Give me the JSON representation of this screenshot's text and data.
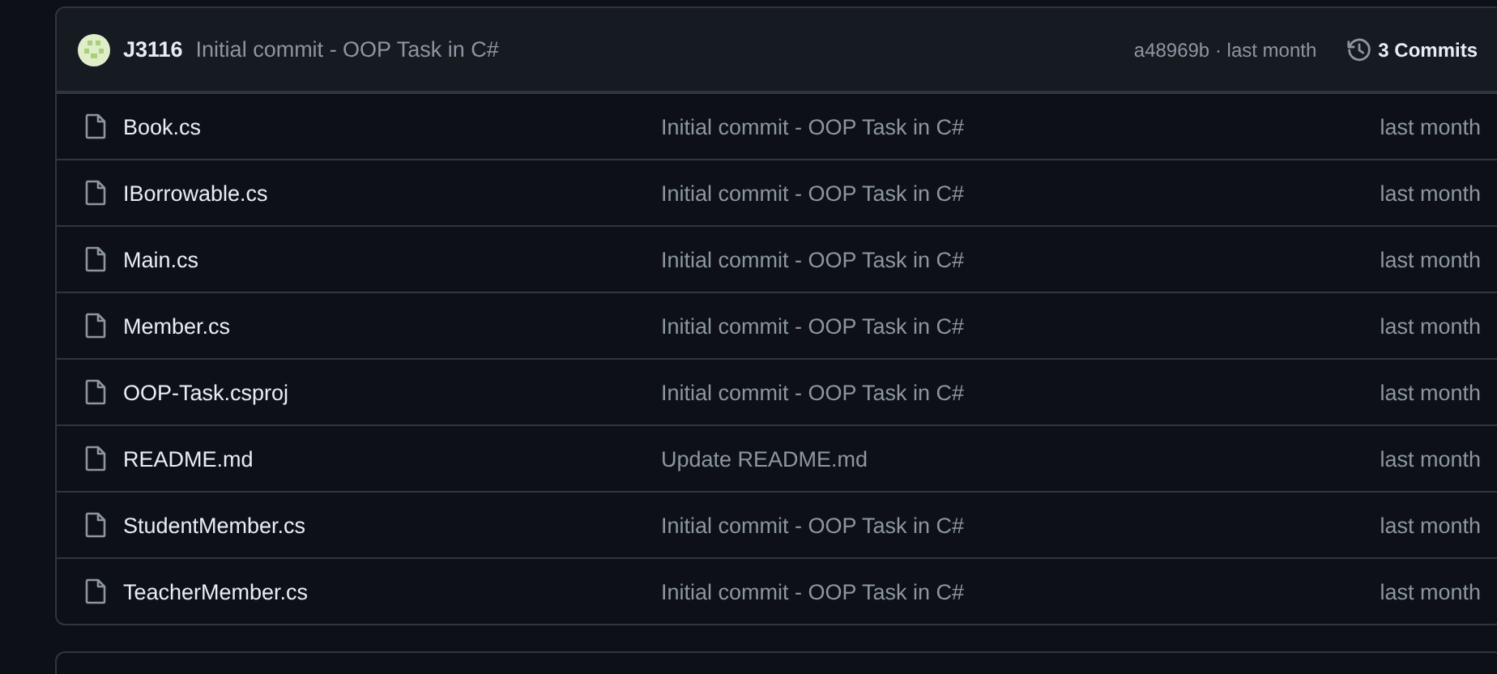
{
  "latest_commit": {
    "author": "J3116",
    "message": "Initial commit - OOP Task in C#",
    "sha_time": "a48969b · last month",
    "commits": "3 Commits"
  },
  "files": [
    {
      "name": "Book.cs",
      "message": "Initial commit - OOP Task in C#",
      "time": "last month"
    },
    {
      "name": "IBorrowable.cs",
      "message": "Initial commit - OOP Task in C#",
      "time": "last month"
    },
    {
      "name": "Main.cs",
      "message": "Initial commit - OOP Task in C#",
      "time": "last month"
    },
    {
      "name": "Member.cs",
      "message": "Initial commit - OOP Task in C#",
      "time": "last month"
    },
    {
      "name": "OOP-Task.csproj",
      "message": "Initial commit - OOP Task in C#",
      "time": "last month"
    },
    {
      "name": "README.md",
      "message": "Update README.md",
      "time": "last month"
    },
    {
      "name": "StudentMember.cs",
      "message": "Initial commit - OOP Task in C#",
      "time": "last month"
    },
    {
      "name": "TeacherMember.cs",
      "message": "Initial commit - OOP Task in C#",
      "time": "last month"
    }
  ]
}
